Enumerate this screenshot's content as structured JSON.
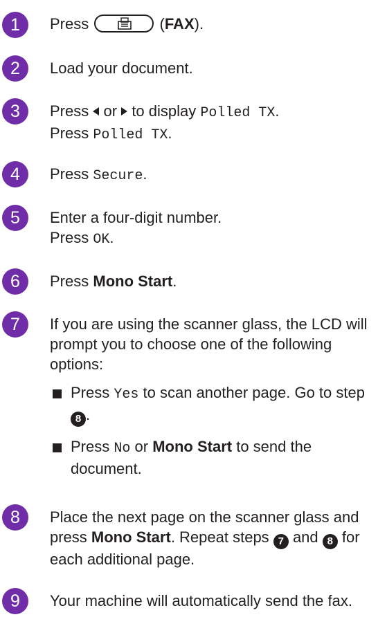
{
  "steps": [
    {
      "num": "1",
      "press": "Press",
      "fax_label": "FAX"
    },
    {
      "num": "2",
      "text": "Load your document."
    },
    {
      "num": "3",
      "press": "Press",
      "or": "or",
      "to_display": "to display",
      "polled_tx": "Polled TX",
      "press2": "Press",
      "polled_tx2": "Polled TX"
    },
    {
      "num": "4",
      "press": "Press",
      "secure": "Secure"
    },
    {
      "num": "5",
      "text": "Enter a four-digit number.",
      "press": "Press",
      "ok": "OK"
    },
    {
      "num": "6",
      "press": "Press",
      "mono_start": "Mono Start"
    },
    {
      "num": "7",
      "text": "If you are using the scanner glass, the LCD will prompt you to choose one of the following options:",
      "bullet1": {
        "press": "Press",
        "yes": "Yes",
        "rest": "to scan another page. Go to step",
        "ref": "8"
      },
      "bullet2": {
        "press": "Press",
        "no": "No",
        "or": "or",
        "mono_start": "Mono Start",
        "rest": "to send the document."
      }
    },
    {
      "num": "8",
      "text1": "Place the next page on the scanner glass and press",
      "mono_start": "Mono Start",
      "text2": ". Repeat steps",
      "ref1": "7",
      "and": "and",
      "ref2": "8",
      "text3": "for each additional page."
    },
    {
      "num": "9",
      "text": "Your machine will automatically send the fax."
    }
  ],
  "colors": {
    "accent": "#6f2da8",
    "text": "#231f20"
  },
  "icons": [
    "fax-key-icon",
    "left-arrow-icon",
    "right-arrow-icon",
    "bullet-square-icon"
  ]
}
